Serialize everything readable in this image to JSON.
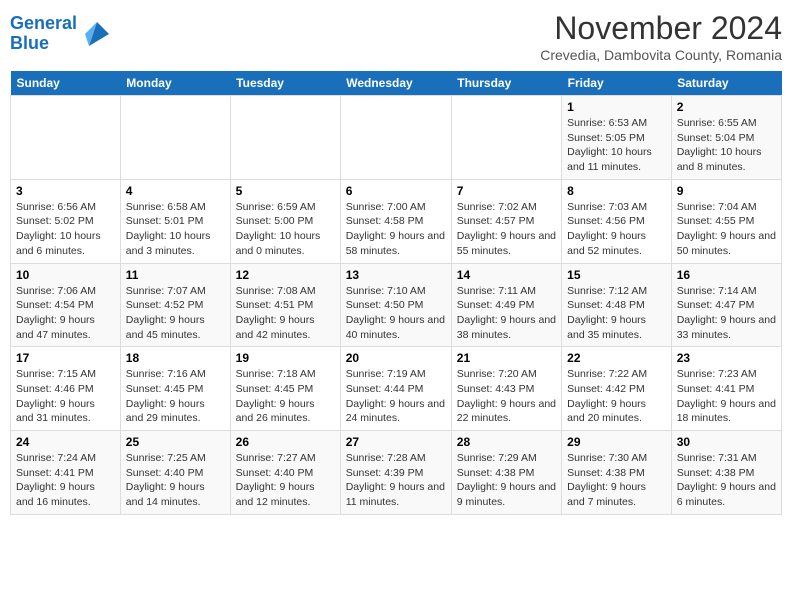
{
  "logo": {
    "line1": "General",
    "line2": "Blue"
  },
  "title": "November 2024",
  "subtitle": "Crevedia, Dambovita County, Romania",
  "weekdays": [
    "Sunday",
    "Monday",
    "Tuesday",
    "Wednesday",
    "Thursday",
    "Friday",
    "Saturday"
  ],
  "weeks": [
    [
      {
        "day": "",
        "info": ""
      },
      {
        "day": "",
        "info": ""
      },
      {
        "day": "",
        "info": ""
      },
      {
        "day": "",
        "info": ""
      },
      {
        "day": "",
        "info": ""
      },
      {
        "day": "1",
        "info": "Sunrise: 6:53 AM\nSunset: 5:05 PM\nDaylight: 10 hours and 11 minutes."
      },
      {
        "day": "2",
        "info": "Sunrise: 6:55 AM\nSunset: 5:04 PM\nDaylight: 10 hours and 8 minutes."
      }
    ],
    [
      {
        "day": "3",
        "info": "Sunrise: 6:56 AM\nSunset: 5:02 PM\nDaylight: 10 hours and 6 minutes."
      },
      {
        "day": "4",
        "info": "Sunrise: 6:58 AM\nSunset: 5:01 PM\nDaylight: 10 hours and 3 minutes."
      },
      {
        "day": "5",
        "info": "Sunrise: 6:59 AM\nSunset: 5:00 PM\nDaylight: 10 hours and 0 minutes."
      },
      {
        "day": "6",
        "info": "Sunrise: 7:00 AM\nSunset: 4:58 PM\nDaylight: 9 hours and 58 minutes."
      },
      {
        "day": "7",
        "info": "Sunrise: 7:02 AM\nSunset: 4:57 PM\nDaylight: 9 hours and 55 minutes."
      },
      {
        "day": "8",
        "info": "Sunrise: 7:03 AM\nSunset: 4:56 PM\nDaylight: 9 hours and 52 minutes."
      },
      {
        "day": "9",
        "info": "Sunrise: 7:04 AM\nSunset: 4:55 PM\nDaylight: 9 hours and 50 minutes."
      }
    ],
    [
      {
        "day": "10",
        "info": "Sunrise: 7:06 AM\nSunset: 4:54 PM\nDaylight: 9 hours and 47 minutes."
      },
      {
        "day": "11",
        "info": "Sunrise: 7:07 AM\nSunset: 4:52 PM\nDaylight: 9 hours and 45 minutes."
      },
      {
        "day": "12",
        "info": "Sunrise: 7:08 AM\nSunset: 4:51 PM\nDaylight: 9 hours and 42 minutes."
      },
      {
        "day": "13",
        "info": "Sunrise: 7:10 AM\nSunset: 4:50 PM\nDaylight: 9 hours and 40 minutes."
      },
      {
        "day": "14",
        "info": "Sunrise: 7:11 AM\nSunset: 4:49 PM\nDaylight: 9 hours and 38 minutes."
      },
      {
        "day": "15",
        "info": "Sunrise: 7:12 AM\nSunset: 4:48 PM\nDaylight: 9 hours and 35 minutes."
      },
      {
        "day": "16",
        "info": "Sunrise: 7:14 AM\nSunset: 4:47 PM\nDaylight: 9 hours and 33 minutes."
      }
    ],
    [
      {
        "day": "17",
        "info": "Sunrise: 7:15 AM\nSunset: 4:46 PM\nDaylight: 9 hours and 31 minutes."
      },
      {
        "day": "18",
        "info": "Sunrise: 7:16 AM\nSunset: 4:45 PM\nDaylight: 9 hours and 29 minutes."
      },
      {
        "day": "19",
        "info": "Sunrise: 7:18 AM\nSunset: 4:45 PM\nDaylight: 9 hours and 26 minutes."
      },
      {
        "day": "20",
        "info": "Sunrise: 7:19 AM\nSunset: 4:44 PM\nDaylight: 9 hours and 24 minutes."
      },
      {
        "day": "21",
        "info": "Sunrise: 7:20 AM\nSunset: 4:43 PM\nDaylight: 9 hours and 22 minutes."
      },
      {
        "day": "22",
        "info": "Sunrise: 7:22 AM\nSunset: 4:42 PM\nDaylight: 9 hours and 20 minutes."
      },
      {
        "day": "23",
        "info": "Sunrise: 7:23 AM\nSunset: 4:41 PM\nDaylight: 9 hours and 18 minutes."
      }
    ],
    [
      {
        "day": "24",
        "info": "Sunrise: 7:24 AM\nSunset: 4:41 PM\nDaylight: 9 hours and 16 minutes."
      },
      {
        "day": "25",
        "info": "Sunrise: 7:25 AM\nSunset: 4:40 PM\nDaylight: 9 hours and 14 minutes."
      },
      {
        "day": "26",
        "info": "Sunrise: 7:27 AM\nSunset: 4:40 PM\nDaylight: 9 hours and 12 minutes."
      },
      {
        "day": "27",
        "info": "Sunrise: 7:28 AM\nSunset: 4:39 PM\nDaylight: 9 hours and 11 minutes."
      },
      {
        "day": "28",
        "info": "Sunrise: 7:29 AM\nSunset: 4:38 PM\nDaylight: 9 hours and 9 minutes."
      },
      {
        "day": "29",
        "info": "Sunrise: 7:30 AM\nSunset: 4:38 PM\nDaylight: 9 hours and 7 minutes."
      },
      {
        "day": "30",
        "info": "Sunrise: 7:31 AM\nSunset: 4:38 PM\nDaylight: 9 hours and 6 minutes."
      }
    ]
  ]
}
